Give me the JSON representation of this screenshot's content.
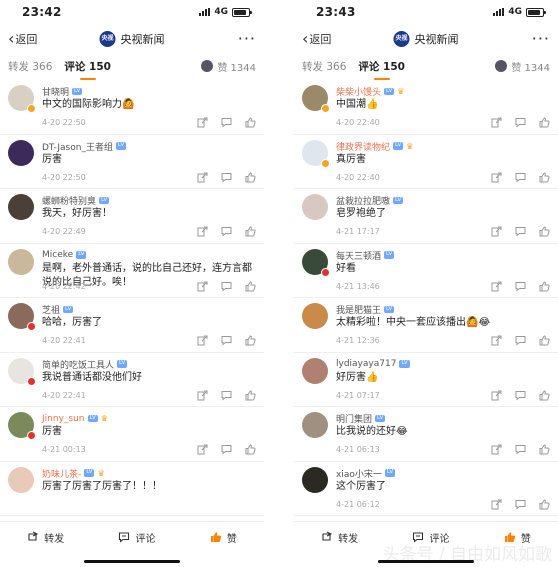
{
  "phones": [
    {
      "status": {
        "time": "23:42",
        "network": "4G"
      },
      "nav": {
        "back_label": "返回",
        "logo_text": "央视",
        "title": "央视新闻"
      },
      "tabs": {
        "repost": "转发 366",
        "comments": "评论 150",
        "likes": "赞 1344"
      },
      "comments": [
        {
          "name": "甘晓明",
          "name_style": "gray",
          "text": "中文的国际影响力🙆",
          "time": "4-20 22:50",
          "avatar_color": "#d9d0c4",
          "badge": "gold"
        },
        {
          "name": "DT-Jason_王者组",
          "name_style": "gray",
          "text": "厉害",
          "time": "4-20 22:50",
          "avatar_color": "#3b2a5a",
          "badge": ""
        },
        {
          "name": "螺蛳粉特别臭",
          "name_style": "gray",
          "text": "我天，好厉害！",
          "time": "4-20 22:49",
          "avatar_color": "#4a4038",
          "badge": ""
        },
        {
          "name": "Miceke",
          "name_style": "gray",
          "text": "是啊，老外普通话，说的比自己还好，连方言都说的比自己好。唉！",
          "time": "4-20 22:42",
          "avatar_color": "#c9b99a",
          "badge": ""
        },
        {
          "name": "芝祖",
          "name_style": "gray",
          "text": "哈哈，厉害了",
          "time": "4-20 22:41",
          "avatar_color": "#8a6a5a",
          "badge": "red"
        },
        {
          "name": "简单的吃饭工具人",
          "name_style": "gray",
          "text": "我说普通话都没他们好",
          "time": "4-20 22:41",
          "avatar_color": "#e8e4e0",
          "badge": "red"
        },
        {
          "name": "Jinny_sun",
          "name_style": "orange",
          "text": "厉害",
          "time": "4-21 00:13",
          "avatar_color": "#7a8a5a",
          "badge": "red"
        },
        {
          "name": "奶味儿茶-",
          "name_style": "orange",
          "text": "厉害了厉害了厉害了！！！",
          "time": "",
          "avatar_color": "#e9c9b8",
          "badge": ""
        }
      ],
      "bottom": {
        "repost": "转发",
        "comment": "评论",
        "like": "赞"
      }
    },
    {
      "status": {
        "time": "23:43",
        "network": "4G"
      },
      "nav": {
        "back_label": "返回",
        "logo_text": "央视",
        "title": "央视新闻"
      },
      "tabs": {
        "repost": "转发 366",
        "comments": "评论 150",
        "likes": "赞 1344"
      },
      "comments": [
        {
          "name": "柴柴小馒头",
          "name_style": "orange",
          "text": "中国潮👍",
          "time": "4-20 22:40",
          "avatar_color": "#9a8a6a",
          "badge": "gold"
        },
        {
          "name": "律政界读物纪",
          "name_style": "orange",
          "text": "真厉害",
          "time": "4-20 22:40",
          "avatar_color": "#e0e6ee",
          "badge": "gold"
        },
        {
          "name": "盆栽拉拉肥嗷",
          "name_style": "gray",
          "text": "皂罗袍绝了",
          "time": "4-21 17:17",
          "avatar_color": "#d8c8c0",
          "badge": ""
        },
        {
          "name": "每天三顿酒",
          "name_style": "gray",
          "text": "好看",
          "time": "4-21 13:46",
          "avatar_color": "#3a4a3a",
          "badge": "red"
        },
        {
          "name": "我是肥猫王",
          "name_style": "gray",
          "text": "太精彩啦！中央一套应该播出🙆😂",
          "time": "4-21 12:36",
          "avatar_color": "#c98a4a",
          "badge": ""
        },
        {
          "name": "lydiayaya717",
          "name_style": "gray",
          "text": "好厉害👍",
          "time": "4-21 07:17",
          "avatar_color": "#b08070",
          "badge": ""
        },
        {
          "name": "明门集团",
          "name_style": "gray",
          "text": "比我说的还好😂",
          "time": "4-21 06:13",
          "avatar_color": "#a09080",
          "badge": ""
        },
        {
          "name": "xiao小宋一",
          "name_style": "gray",
          "text": "这个厉害了",
          "time": "4-21 06:12",
          "avatar_color": "#2a2a22",
          "badge": ""
        }
      ],
      "bottom": {
        "repost": "转发",
        "comment": "评论",
        "like": "赞"
      },
      "watermark": "头条号 / 自由如风如歌"
    }
  ],
  "colors": {
    "accent": "#ff8200",
    "like_active": "#ff8200",
    "name_orange": "#eb7350"
  }
}
